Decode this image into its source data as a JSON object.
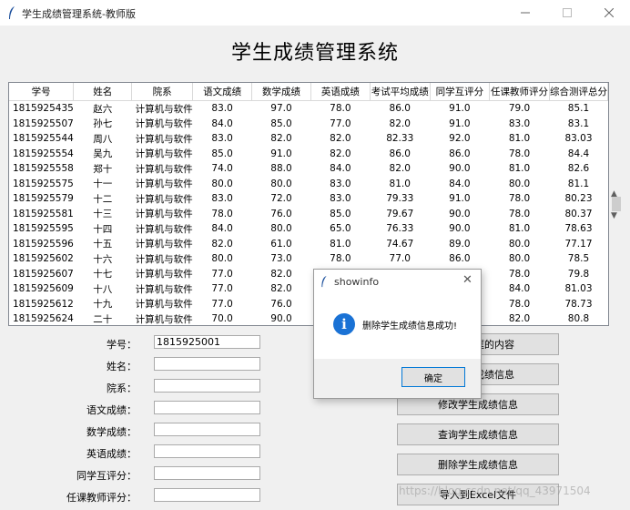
{
  "window": {
    "title": "学生成绩管理系统-教师版",
    "heading": "学生成绩管理系统"
  },
  "table": {
    "columns": [
      "学号",
      "姓名",
      "院系",
      "语文成绩",
      "数学成绩",
      "英语成绩",
      "考试平均成绩",
      "同学互评分",
      "任课教师评分",
      "综合测评总分"
    ],
    "rows": [
      [
        "1815925435",
        "赵六",
        "计算机与软件",
        "83.0",
        "97.0",
        "78.0",
        "86.0",
        "91.0",
        "79.0",
        "85.1"
      ],
      [
        "1815925507",
        "孙七",
        "计算机与软件",
        "84.0",
        "85.0",
        "77.0",
        "82.0",
        "91.0",
        "83.0",
        "83.1"
      ],
      [
        "1815925544",
        "周八",
        "计算机与软件",
        "83.0",
        "82.0",
        "82.0",
        "82.33",
        "92.0",
        "81.0",
        "83.03"
      ],
      [
        "1815925554",
        "吴九",
        "计算机与软件",
        "85.0",
        "91.0",
        "82.0",
        "86.0",
        "86.0",
        "78.0",
        "84.4"
      ],
      [
        "1815925558",
        "郑十",
        "计算机与软件",
        "74.0",
        "88.0",
        "84.0",
        "82.0",
        "90.0",
        "81.0",
        "82.6"
      ],
      [
        "1815925575",
        "十一",
        "计算机与软件",
        "80.0",
        "80.0",
        "83.0",
        "81.0",
        "84.0",
        "80.0",
        "81.1"
      ],
      [
        "1815925579",
        "十二",
        "计算机与软件",
        "83.0",
        "72.0",
        "83.0",
        "79.33",
        "91.0",
        "78.0",
        "80.23"
      ],
      [
        "1815925581",
        "十三",
        "计算机与软件",
        "78.0",
        "76.0",
        "85.0",
        "79.67",
        "90.0",
        "78.0",
        "80.37"
      ],
      [
        "1815925595",
        "十四",
        "计算机与软件",
        "84.0",
        "80.0",
        "65.0",
        "76.33",
        "90.0",
        "81.0",
        "78.63"
      ],
      [
        "1815925596",
        "十五",
        "计算机与软件",
        "82.0",
        "61.0",
        "81.0",
        "74.67",
        "89.0",
        "80.0",
        "77.17"
      ],
      [
        "1815925602",
        "十六",
        "计算机与软件",
        "80.0",
        "73.0",
        "78.0",
        "77.0",
        "86.0",
        "80.0",
        "78.5"
      ],
      [
        "1815925607",
        "十七",
        "计算机与软件",
        "77.0",
        "82.0",
        "",
        "",
        "",
        "78.0",
        "79.8"
      ],
      [
        "1815925609",
        "十八",
        "计算机与软件",
        "77.0",
        "82.0",
        "",
        "",
        "",
        "84.0",
        "81.03"
      ],
      [
        "1815925612",
        "十九",
        "计算机与软件",
        "77.0",
        "76.0",
        "",
        "",
        "",
        "78.0",
        "78.73"
      ],
      [
        "1815925624",
        "二十",
        "计算机与软件",
        "70.0",
        "90.0",
        "",
        "",
        "",
        "82.0",
        "80.8"
      ]
    ]
  },
  "form": {
    "fields": [
      {
        "label": "学号：",
        "value": "1815925001"
      },
      {
        "label": "姓名：",
        "value": ""
      },
      {
        "label": "院系：",
        "value": ""
      },
      {
        "label": "语文成绩：",
        "value": ""
      },
      {
        "label": "数学成绩：",
        "value": ""
      },
      {
        "label": "英语成绩：",
        "value": ""
      },
      {
        "label": "同学互评分：",
        "value": ""
      },
      {
        "label": "任课教师评分：",
        "value": ""
      }
    ]
  },
  "buttons": {
    "clear": "框的内容",
    "add": "成绩信息",
    "modify": "修改学生成绩信息",
    "query": "查询学生成绩信息",
    "delete": "删除学生成绩信息",
    "export": "导入到Excel文件"
  },
  "dialog": {
    "title": "showinfo",
    "message": "删除学生成绩信息成功!",
    "ok": "确定"
  },
  "watermark": "https://blog.csdn.net/qq_43971504"
}
